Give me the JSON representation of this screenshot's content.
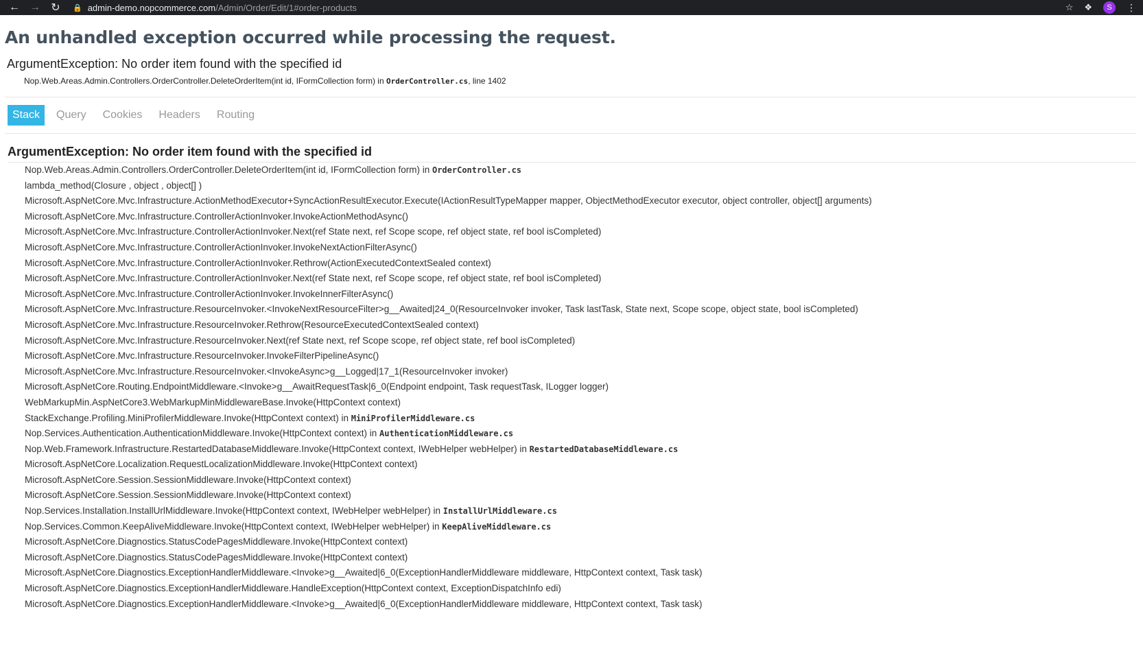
{
  "browser": {
    "url_host": "admin-demo.nopcommerce.com",
    "url_path": "/Admin/Order/Edit/1#order-products",
    "profile_initial": "S"
  },
  "error": {
    "title": "An unhandled exception occurred while processing the request.",
    "message": "ArgumentException: No order item found with the specified id",
    "location_method": "Nop.Web.Areas.Admin.Controllers.OrderController.DeleteOrderItem(int id, IFormCollection form) in ",
    "location_file": "OrderController.cs",
    "location_line": ", line 1402"
  },
  "tabs": [
    "Stack",
    "Query",
    "Cookies",
    "Headers",
    "Routing"
  ],
  "stack": {
    "heading": "ArgumentException: No order item found with the specified id",
    "frames": [
      {
        "method": "Nop.Web.Areas.Admin.Controllers.OrderController.DeleteOrderItem(int id, IFormCollection form) in ",
        "file": "OrderController.cs"
      },
      {
        "method": "lambda_method(Closure , object , object[] )",
        "file": ""
      },
      {
        "method": "Microsoft.AspNetCore.Mvc.Infrastructure.ActionMethodExecutor+SyncActionResultExecutor.Execute(IActionResultTypeMapper mapper, ObjectMethodExecutor executor, object controller, object[] arguments)",
        "file": ""
      },
      {
        "method": "Microsoft.AspNetCore.Mvc.Infrastructure.ControllerActionInvoker.InvokeActionMethodAsync()",
        "file": ""
      },
      {
        "method": "Microsoft.AspNetCore.Mvc.Infrastructure.ControllerActionInvoker.Next(ref State next, ref Scope scope, ref object state, ref bool isCompleted)",
        "file": ""
      },
      {
        "method": "Microsoft.AspNetCore.Mvc.Infrastructure.ControllerActionInvoker.InvokeNextActionFilterAsync()",
        "file": ""
      },
      {
        "method": "Microsoft.AspNetCore.Mvc.Infrastructure.ControllerActionInvoker.Rethrow(ActionExecutedContextSealed context)",
        "file": ""
      },
      {
        "method": "Microsoft.AspNetCore.Mvc.Infrastructure.ControllerActionInvoker.Next(ref State next, ref Scope scope, ref object state, ref bool isCompleted)",
        "file": ""
      },
      {
        "method": "Microsoft.AspNetCore.Mvc.Infrastructure.ControllerActionInvoker.InvokeInnerFilterAsync()",
        "file": ""
      },
      {
        "method": "Microsoft.AspNetCore.Mvc.Infrastructure.ResourceInvoker.<InvokeNextResourceFilter>g__Awaited|24_0(ResourceInvoker invoker, Task lastTask, State next, Scope scope, object state, bool isCompleted)",
        "file": ""
      },
      {
        "method": "Microsoft.AspNetCore.Mvc.Infrastructure.ResourceInvoker.Rethrow(ResourceExecutedContextSealed context)",
        "file": ""
      },
      {
        "method": "Microsoft.AspNetCore.Mvc.Infrastructure.ResourceInvoker.Next(ref State next, ref Scope scope, ref object state, ref bool isCompleted)",
        "file": ""
      },
      {
        "method": "Microsoft.AspNetCore.Mvc.Infrastructure.ResourceInvoker.InvokeFilterPipelineAsync()",
        "file": ""
      },
      {
        "method": "Microsoft.AspNetCore.Mvc.Infrastructure.ResourceInvoker.<InvokeAsync>g__Logged|17_1(ResourceInvoker invoker)",
        "file": ""
      },
      {
        "method": "Microsoft.AspNetCore.Routing.EndpointMiddleware.<Invoke>g__AwaitRequestTask|6_0(Endpoint endpoint, Task requestTask, ILogger logger)",
        "file": ""
      },
      {
        "method": "WebMarkupMin.AspNetCore3.WebMarkupMinMiddlewareBase.Invoke(HttpContext context)",
        "file": ""
      },
      {
        "method": "StackExchange.Profiling.MiniProfilerMiddleware.Invoke(HttpContext context) in ",
        "file": "MiniProfilerMiddleware.cs"
      },
      {
        "method": "Nop.Services.Authentication.AuthenticationMiddleware.Invoke(HttpContext context) in ",
        "file": "AuthenticationMiddleware.cs"
      },
      {
        "method": "Nop.Web.Framework.Infrastructure.RestartedDatabaseMiddleware.Invoke(HttpContext context, IWebHelper webHelper) in ",
        "file": "RestartedDatabaseMiddleware.cs"
      },
      {
        "method": "Microsoft.AspNetCore.Localization.RequestLocalizationMiddleware.Invoke(HttpContext context)",
        "file": ""
      },
      {
        "method": "Microsoft.AspNetCore.Session.SessionMiddleware.Invoke(HttpContext context)",
        "file": ""
      },
      {
        "method": "Microsoft.AspNetCore.Session.SessionMiddleware.Invoke(HttpContext context)",
        "file": ""
      },
      {
        "method": "Nop.Services.Installation.InstallUrlMiddleware.Invoke(HttpContext context, IWebHelper webHelper) in ",
        "file": "InstallUrlMiddleware.cs"
      },
      {
        "method": "Nop.Services.Common.KeepAliveMiddleware.Invoke(HttpContext context, IWebHelper webHelper) in ",
        "file": "KeepAliveMiddleware.cs"
      },
      {
        "method": "Microsoft.AspNetCore.Diagnostics.StatusCodePagesMiddleware.Invoke(HttpContext context)",
        "file": ""
      },
      {
        "method": "Microsoft.AspNetCore.Diagnostics.StatusCodePagesMiddleware.Invoke(HttpContext context)",
        "file": ""
      },
      {
        "method": "Microsoft.AspNetCore.Diagnostics.ExceptionHandlerMiddleware.<Invoke>g__Awaited|6_0(ExceptionHandlerMiddleware middleware, HttpContext context, Task task)",
        "file": ""
      },
      {
        "method": "Microsoft.AspNetCore.Diagnostics.ExceptionHandlerMiddleware.HandleException(HttpContext context, ExceptionDispatchInfo edi)",
        "file": ""
      },
      {
        "method": "Microsoft.AspNetCore.Diagnostics.ExceptionHandlerMiddleware.<Invoke>g__Awaited|6_0(ExceptionHandlerMiddleware middleware, HttpContext context, Task task)",
        "file": ""
      }
    ]
  }
}
